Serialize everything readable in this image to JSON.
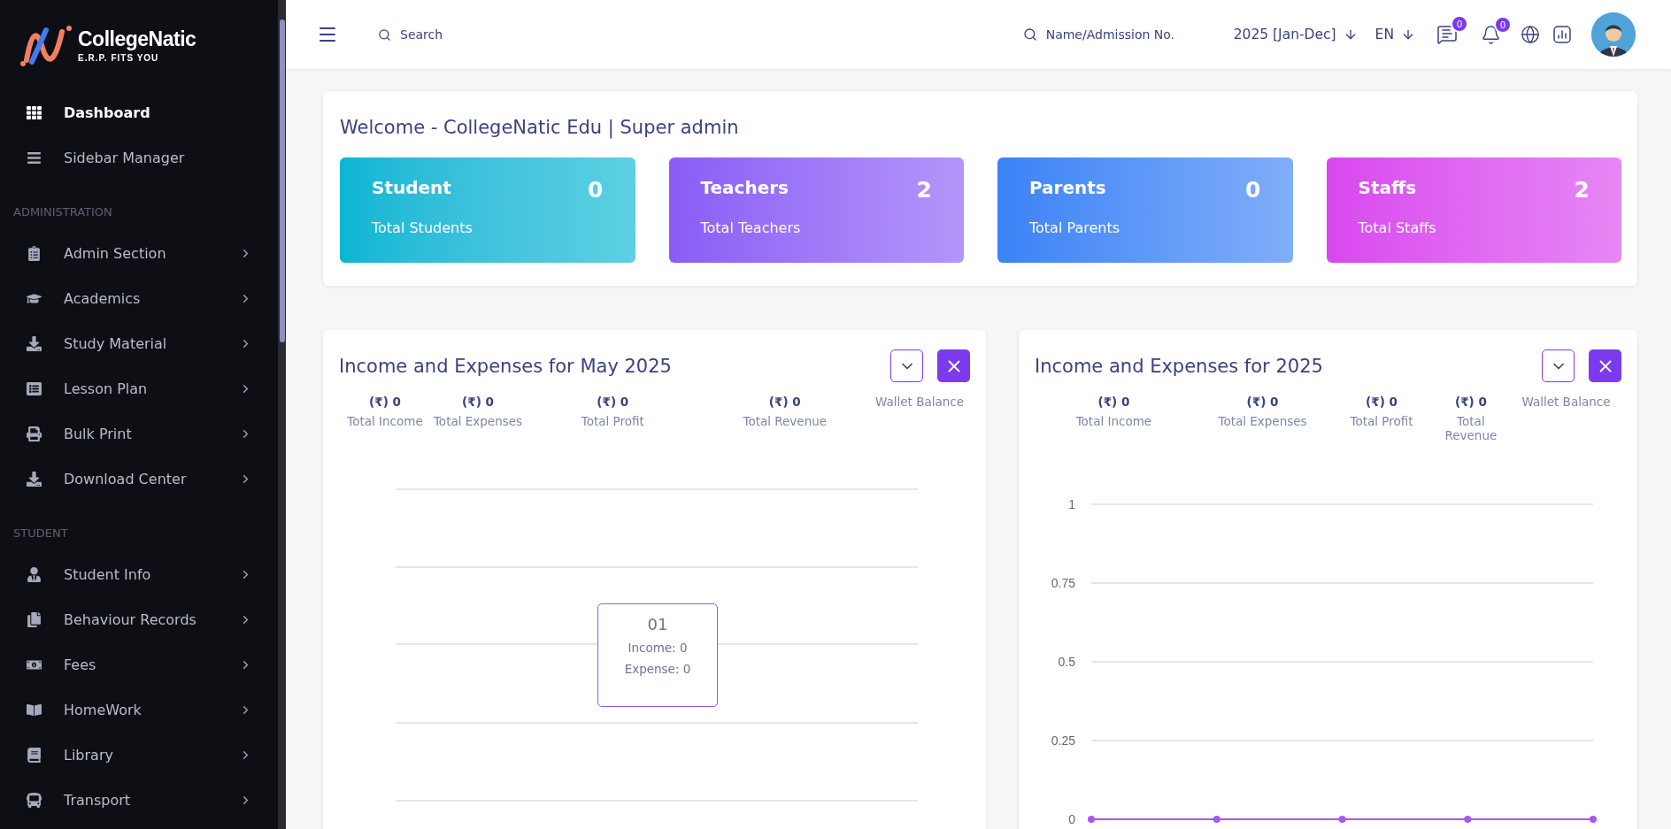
{
  "sidebar": {
    "logo": {
      "name": "CollegeNatic",
      "tagline": "E.R.P. FITS YOU"
    },
    "sections": [
      {
        "items": [
          {
            "label": "Dashboard",
            "selected": true,
            "submenu": false
          },
          {
            "label": "Sidebar Manager",
            "selected": false,
            "submenu": false
          }
        ]
      },
      {
        "heading": "ADMINISTRATION",
        "items": [
          {
            "label": "Admin Section",
            "selected": false,
            "submenu": true
          },
          {
            "label": "Academics",
            "selected": false,
            "submenu": true
          },
          {
            "label": "Study Material",
            "selected": false,
            "submenu": true
          },
          {
            "label": "Lesson Plan",
            "selected": false,
            "submenu": true
          },
          {
            "label": "Bulk Print",
            "selected": false,
            "submenu": true
          },
          {
            "label": "Download Center",
            "selected": false,
            "submenu": true
          }
        ]
      },
      {
        "heading": "STUDENT",
        "items": [
          {
            "label": "Student Info",
            "selected": false,
            "submenu": true
          },
          {
            "label": "Behaviour Records",
            "selected": false,
            "submenu": true
          },
          {
            "label": "Fees",
            "selected": false,
            "submenu": true
          },
          {
            "label": "HomeWork",
            "selected": false,
            "submenu": true
          },
          {
            "label": "Library",
            "selected": false,
            "submenu": true
          },
          {
            "label": "Transport",
            "selected": false,
            "submenu": true
          }
        ]
      }
    ]
  },
  "header": {
    "search": {
      "placeholder": "Search"
    },
    "admission_search": {
      "placeholder": "Name/Admission No."
    },
    "session": "2025 [Jan-Dec]",
    "language": "EN",
    "messages_badge": "0",
    "notifications_badge": "0"
  },
  "welcome": {
    "title": "Welcome - CollegeNatic Edu | Super admin",
    "cards": [
      {
        "title": "Student",
        "count": "0",
        "subtitle": "Total Students",
        "color": "#06b6d4"
      },
      {
        "title": "Teachers",
        "count": "2",
        "subtitle": "Total Teachers",
        "color": "#8b5cf6"
      },
      {
        "title": "Parents",
        "count": "0",
        "subtitle": "Total Parents",
        "color": "#3b82f6"
      },
      {
        "title": "Staffs",
        "count": "2",
        "subtitle": "Total Staffs",
        "color": "#d946ef"
      }
    ]
  },
  "panels": [
    {
      "title": "Income and Expenses for May 2025",
      "stats": [
        {
          "value": "(₹) 0",
          "label": "Total Income"
        },
        {
          "value": "(₹) 0",
          "label": "Total Expenses"
        },
        {
          "value": "(₹) 0",
          "label": "Total Profit"
        },
        {
          "value": "(₹) 0",
          "label": "Total Revenue"
        },
        {
          "label": "Wallet Balance"
        }
      ],
      "tooltip": {
        "title": "01",
        "lines": [
          "Income: 0",
          "Expense: 0"
        ]
      }
    },
    {
      "title": "Income and Expenses for 2025",
      "stats": [
        {
          "value": "(₹) 0",
          "label": "Total Income"
        },
        {
          "value": "(₹) 0",
          "label": "Total Expenses"
        },
        {
          "value": "(₹) 0",
          "label": "Total Profit"
        },
        {
          "value": "(₹) 0",
          "label": "Total Revenue"
        },
        {
          "label": "Wallet Balance"
        }
      ],
      "chart_data": {
        "type": "line",
        "grid": true,
        "ylim": [
          0,
          1
        ],
        "yticks": [
          0,
          0.25,
          0.5,
          0.75,
          1
        ],
        "series": [
          {
            "color": "#a855f7",
            "marker": "circle",
            "values": [
              0,
              0,
              0,
              0,
              0
            ]
          }
        ]
      }
    }
  ]
}
